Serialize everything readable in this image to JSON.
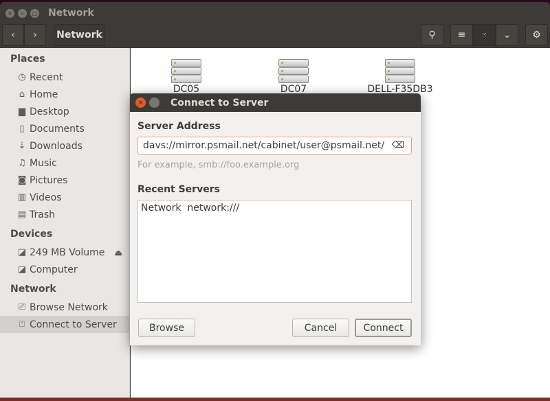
{
  "window": {
    "title": "Network"
  },
  "toolbar": {
    "location": "Network",
    "back_icon": "chevron-left",
    "forward_icon": "chevron-right"
  },
  "sidebar": {
    "places_header": "Places",
    "places": [
      {
        "label": "Recent",
        "icon": "clock"
      },
      {
        "label": "Home",
        "icon": "home"
      },
      {
        "label": "Desktop",
        "icon": "folder"
      },
      {
        "label": "Documents",
        "icon": "document"
      },
      {
        "label": "Downloads",
        "icon": "download"
      },
      {
        "label": "Music",
        "icon": "music"
      },
      {
        "label": "Pictures",
        "icon": "camera"
      },
      {
        "label": "Videos",
        "icon": "film"
      },
      {
        "label": "Trash",
        "icon": "trash"
      }
    ],
    "devices_header": "Devices",
    "devices": [
      {
        "label": "249 MB Volume",
        "icon": "drive"
      },
      {
        "label": "Computer",
        "icon": "drive"
      }
    ],
    "network_header": "Network",
    "network": [
      {
        "label": "Browse Network",
        "icon": "network"
      },
      {
        "label": "Connect to Server",
        "icon": "server"
      }
    ]
  },
  "content": {
    "servers": [
      "DC05",
      "DC07",
      "DELL-F35DB3"
    ]
  },
  "dialog": {
    "title": "Connect to Server",
    "server_address_label": "Server Address",
    "server_address_value": "davs://mirror.psmail.net/cabinet/user@psmail.net/",
    "hint": "For example, smb://foo.example.org",
    "recent_label": "Recent Servers",
    "recent": [
      {
        "name": "Network",
        "uri": "network:///"
      }
    ],
    "browse": "Browse",
    "cancel": "Cancel",
    "connect": "Connect"
  }
}
